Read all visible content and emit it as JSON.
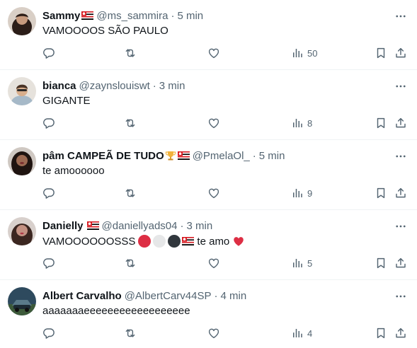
{
  "tweets": [
    {
      "name": "Sammy",
      "handle": "@ms_sammira",
      "dot": "·",
      "time": "5 min",
      "text": "VAMOOOOS SÃO PAULO",
      "views": "50",
      "avatar_color": "#6b4a3a",
      "emoji": [
        "flag-sao-paulo"
      ]
    },
    {
      "name": "bianca",
      "handle": "@zaynslouiswt",
      "dot": "·",
      "time": "3 min",
      "text": "GIGANTE",
      "views": "8",
      "avatar_color": "#c9a27a",
      "emoji": []
    },
    {
      "name": "pâm CAMPEÃ DE TUDO",
      "handle": "@PmelaOl_",
      "dot": "·",
      "time": "5 min",
      "text": "te amoooooo",
      "views": "9",
      "avatar_color": "#3a2a24",
      "emoji": [
        "trophy",
        "flag-sao-paulo"
      ]
    },
    {
      "name": "Danielly",
      "handle": "@daniellyads04",
      "dot": "·",
      "time": "3 min",
      "text_before": "VAMOOOOOOSSS",
      "text_after": "te amo",
      "views": "5",
      "avatar_color": "#8a5a4a",
      "emoji": [
        "flag-sao-paulo",
        "red-circle",
        "white-circle",
        "black-circle",
        "flag-sao-paulo",
        "red-heart"
      ]
    },
    {
      "name": "Albert Carvalho",
      "handle": "@AlbertCarv44SP",
      "dot": "·",
      "time": "4 min",
      "text": "aaaaaaaeeeeeeeeeeeeeeeeee",
      "views": "4",
      "avatar_color": "#2e4a5e",
      "emoji": []
    }
  ],
  "colors": {
    "text": "#0f1419",
    "secondary": "#536471",
    "divider": "#eff3f4",
    "flag_red": "#d71920",
    "flag_black": "#000000"
  },
  "icons": [
    "reply-icon",
    "retweet-icon",
    "like-icon",
    "views-icon",
    "bookmark-icon",
    "share-icon",
    "more-icon"
  ]
}
